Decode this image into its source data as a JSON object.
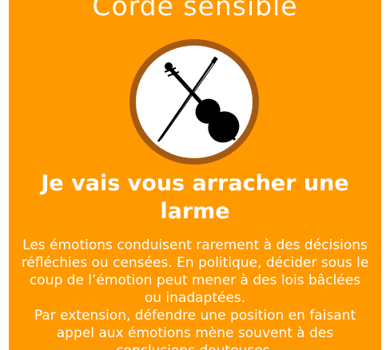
{
  "card": {
    "title": "Corde sensible",
    "emblem_icon": "violin-crossed-icon",
    "subtitle": "Je vais vous arracher une larme",
    "paragraphs": [
      "Les émotions conduisent rarement à des décisions réfléchies ou censées. En politique, décider sous le coup de l’émotion peut mener à des lois bâclées ou inadaptées.",
      "Par extension, défendre une position en faisant appel aux émotions mène souvent à des conclusions douteuses."
    ]
  },
  "colors": {
    "background": "#ff9900",
    "emblem_border": "#a55a14",
    "text": "#ffffff",
    "icon": "#000000"
  }
}
